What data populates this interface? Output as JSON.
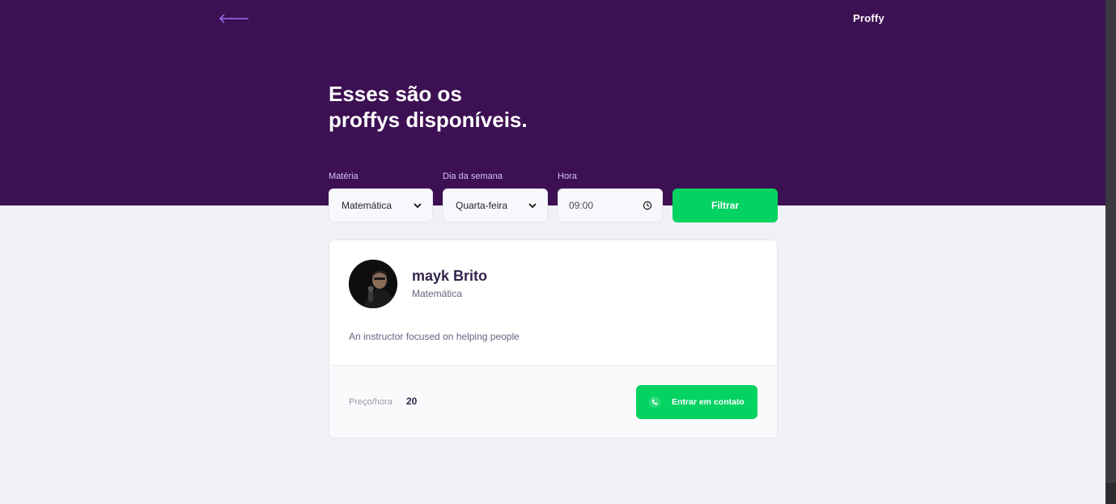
{
  "header": {
    "logo": "Proffy",
    "back_icon": "arrow-left-icon"
  },
  "hero": {
    "title_line1": "Esses são os",
    "title_line2": "proffys disponíveis."
  },
  "filters": {
    "subject": {
      "label": "Matéria",
      "value": "Matemática"
    },
    "weekday": {
      "label": "Dia da semana",
      "value": "Quarta-feira"
    },
    "time": {
      "label": "Hora",
      "value": "09:00"
    },
    "submit_label": "Filtrar"
  },
  "teacher": {
    "name": "mayk Brito",
    "subject": "Matemática",
    "bio": "An instructor focused on helping people",
    "price_label": "Preço/hora",
    "price_value": "20",
    "contact_label": "Entrar em contato",
    "contact_icon": "whatsapp-icon"
  },
  "colors": {
    "primary": "#3C1052",
    "secondary": "#04D361",
    "background": "#F0F0F7",
    "label": "#D4C2FF",
    "text_title": "#32264D",
    "text_body": "#6A6180"
  }
}
